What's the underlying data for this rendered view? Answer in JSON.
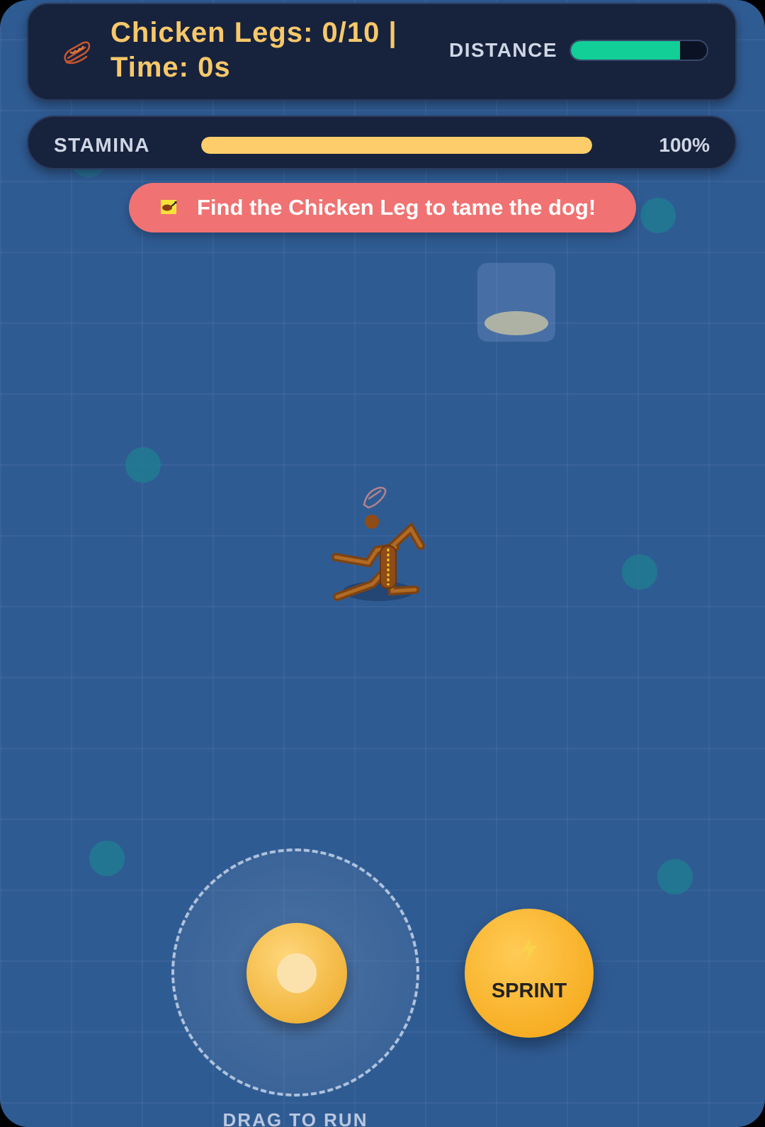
{
  "hud": {
    "score_text": "Chicken Legs: 0/10 | Time: 0s",
    "distance_label": "DISTANCE",
    "distance_fill": 0.8,
    "stamina_label": "STAMINA",
    "stamina_value": "100%",
    "stamina_fill": 1.0
  },
  "hint": {
    "text": "Find the Chicken Leg to tame the dog!",
    "icon": "chicken-leg-icon"
  },
  "controls": {
    "joystick_label": "DRAG TO RUN",
    "sprint_label": "SPRINT",
    "sprint_icon": "lightning-bolt-icon"
  },
  "colors": {
    "background": "#2f5b93",
    "hud_panel": "#17223d",
    "score_text": "#f7c86a",
    "distance_fill": "#12cf97",
    "stamina_fill": "#fccd6a",
    "hint_banner": "#f07272",
    "button_gold": "#f7ad22"
  }
}
